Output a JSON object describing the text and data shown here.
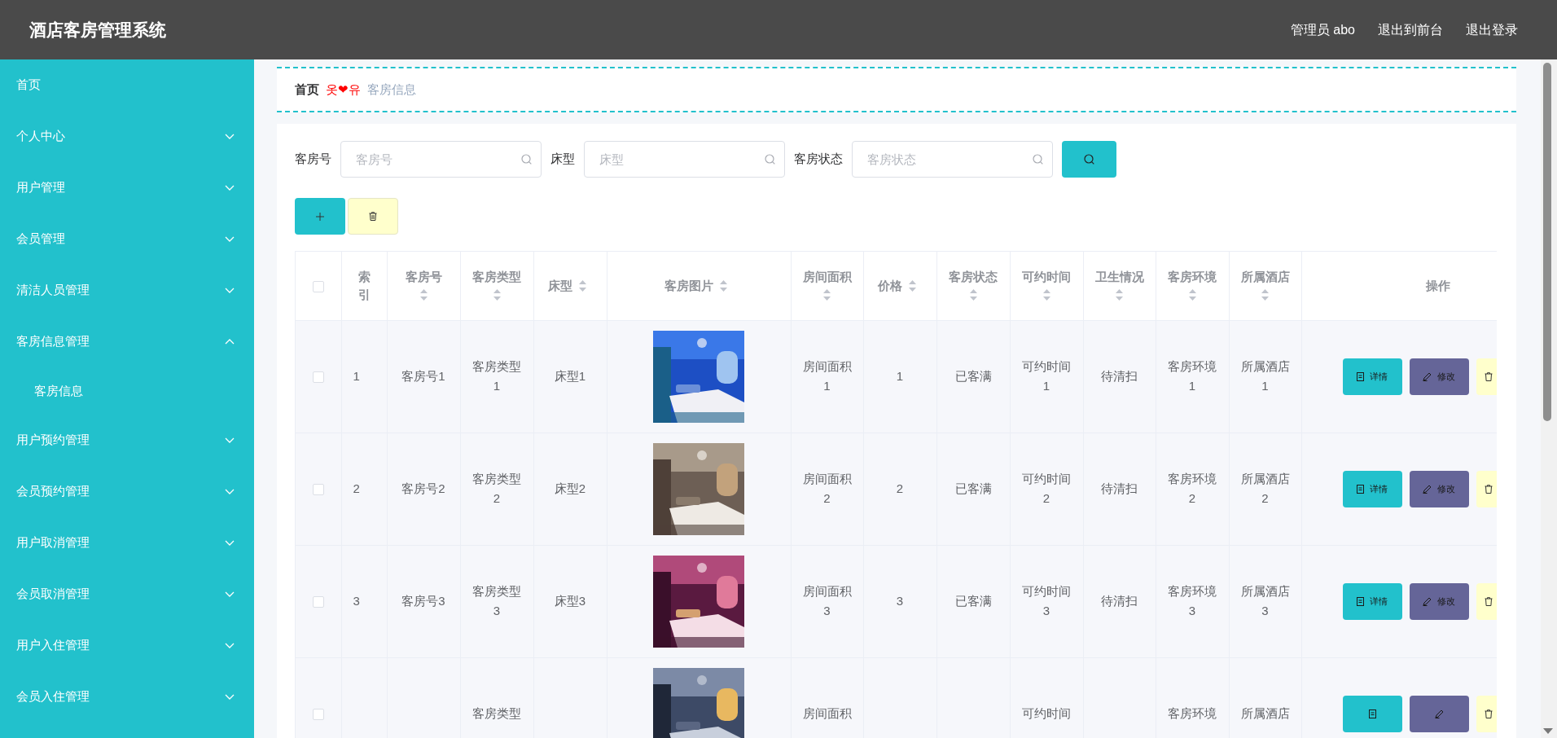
{
  "header": {
    "title": "酒店客房管理系统",
    "links": [
      "管理员 abo",
      "退出到前台",
      "退出登录"
    ]
  },
  "sidebar": {
    "items": [
      {
        "label": "首页",
        "expandable": false
      },
      {
        "label": "个人中心",
        "expandable": true,
        "expanded": false
      },
      {
        "label": "用户管理",
        "expandable": true,
        "expanded": false
      },
      {
        "label": "会员管理",
        "expandable": true,
        "expanded": false
      },
      {
        "label": "清洁人员管理",
        "expandable": true,
        "expanded": false
      },
      {
        "label": "客房信息管理",
        "expandable": true,
        "expanded": true,
        "children": [
          {
            "label": "客房信息"
          }
        ]
      },
      {
        "label": "用户预约管理",
        "expandable": true,
        "expanded": false
      },
      {
        "label": "会员预约管理",
        "expandable": true,
        "expanded": false
      },
      {
        "label": "用户取消管理",
        "expandable": true,
        "expanded": false
      },
      {
        "label": "会员取消管理",
        "expandable": true,
        "expanded": false
      },
      {
        "label": "用户入住管理",
        "expandable": true,
        "expanded": false
      },
      {
        "label": "会员入住管理",
        "expandable": true,
        "expanded": false
      }
    ]
  },
  "breadcrumb": {
    "home": "首页",
    "separator": "옷❤유",
    "current": "客房信息"
  },
  "search": {
    "fields": [
      {
        "label": "客房号",
        "placeholder": "客房号"
      },
      {
        "label": "床型",
        "placeholder": "床型"
      },
      {
        "label": "客房状态",
        "placeholder": "客房状态"
      }
    ]
  },
  "table": {
    "select_all": {
      "checked": false
    },
    "columns": [
      {
        "label": "索引",
        "kind": "text",
        "sortable": false
      },
      {
        "label": "客房号",
        "kind": "text",
        "sortable": true
      },
      {
        "label": "客房类型",
        "kind": "text",
        "sortable": true
      },
      {
        "label": "床型",
        "kind": "text",
        "sortable": true
      },
      {
        "label": "客房图片",
        "kind": "picture",
        "sortable": true
      },
      {
        "label": "房间面积",
        "kind": "text",
        "sortable": true
      },
      {
        "label": "价格",
        "kind": "text",
        "sortable": true
      },
      {
        "label": "客房状态",
        "kind": "text",
        "sortable": true
      },
      {
        "label": "可约时间",
        "kind": "text",
        "sortable": true
      },
      {
        "label": "卫生情况",
        "kind": "text",
        "sortable": true
      },
      {
        "label": "客房环境",
        "kind": "text",
        "sortable": true
      },
      {
        "label": "所属酒店",
        "kind": "text",
        "sortable": true
      },
      {
        "label": "操作",
        "kind": "actions",
        "sortable": false
      }
    ],
    "rows": [
      {
        "checked": false,
        "cells": [
          "1",
          "客房号1",
          "客房类型1",
          "床型1",
          null,
          "房间面积1",
          "1",
          "已客满",
          "可约时间1",
          "待清扫",
          "客房环境1",
          "所属酒店1",
          null
        ],
        "actions": [
          {
            "kind": "detail",
            "label": "详情"
          },
          {
            "kind": "edit",
            "label": "修改"
          },
          {
            "kind": "delete"
          }
        ]
      },
      {
        "checked": false,
        "cells": [
          "2",
          "客房号2",
          "客房类型2",
          "床型2",
          null,
          "房间面积2",
          "2",
          "已客满",
          "可约时间2",
          "待清扫",
          "客房环境2",
          "所属酒店2",
          null
        ],
        "actions": [
          {
            "kind": "detail",
            "label": "详情"
          },
          {
            "kind": "edit",
            "label": "修改"
          },
          {
            "kind": "delete"
          }
        ]
      },
      {
        "checked": false,
        "cells": [
          "3",
          "客房号3",
          "客房类型3",
          "床型3",
          null,
          "房间面积3",
          "3",
          "已客满",
          "可约时间3",
          "待清扫",
          "客房环境3",
          "所属酒店3",
          null
        ],
        "actions": [
          {
            "kind": "detail",
            "label": "详情"
          },
          {
            "kind": "edit",
            "label": "修改"
          },
          {
            "kind": "delete"
          }
        ]
      },
      {
        "checked": false,
        "cells": [
          null,
          null,
          "客房类型",
          null,
          null,
          "房间面积",
          null,
          null,
          "可约时间",
          null,
          "客房环境",
          "所属酒店",
          null
        ],
        "actions": [
          {
            "kind": "detail"
          },
          {
            "kind": "edit"
          },
          {
            "kind": "delete"
          }
        ]
      }
    ]
  }
}
